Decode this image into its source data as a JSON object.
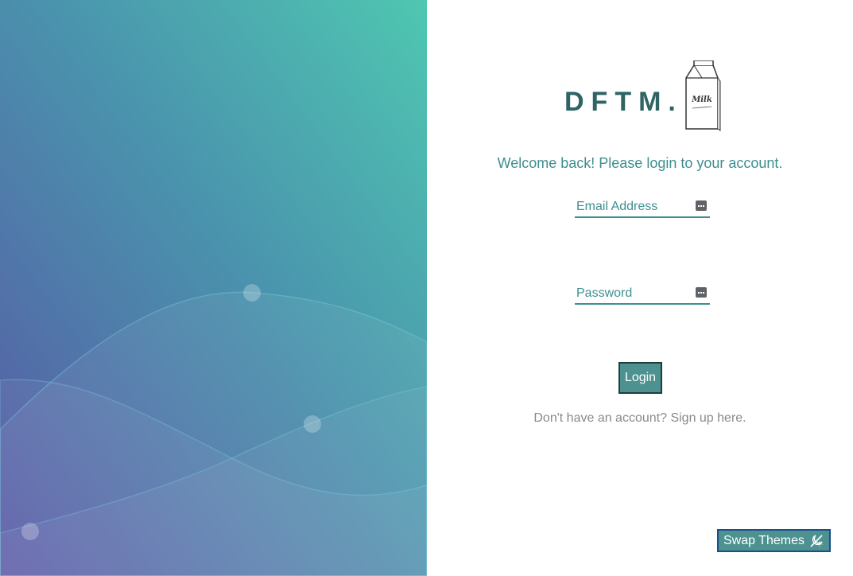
{
  "logo": {
    "text": "DFTM.",
    "carton_label": "Milk"
  },
  "welcome_message": "Welcome back! Please login to your account.",
  "form": {
    "email": {
      "placeholder": "Email Address",
      "value": "",
      "icon": "password-manager-key-icon"
    },
    "password": {
      "placeholder": "Password",
      "value": "",
      "icon": "password-manager-key-icon"
    },
    "login_label": "Login"
  },
  "signup_prompt": "Don't have an account? Sign up here.",
  "theme_toggle": {
    "label": "Swap Themes",
    "icon": "theme-swap-icon"
  },
  "colors": {
    "accent": "#3e8f8f",
    "logo": "#2f6464",
    "button_bg": "#4d9191",
    "gradient_top": "#4fc7b1",
    "gradient_bottom": "#5856a5"
  }
}
